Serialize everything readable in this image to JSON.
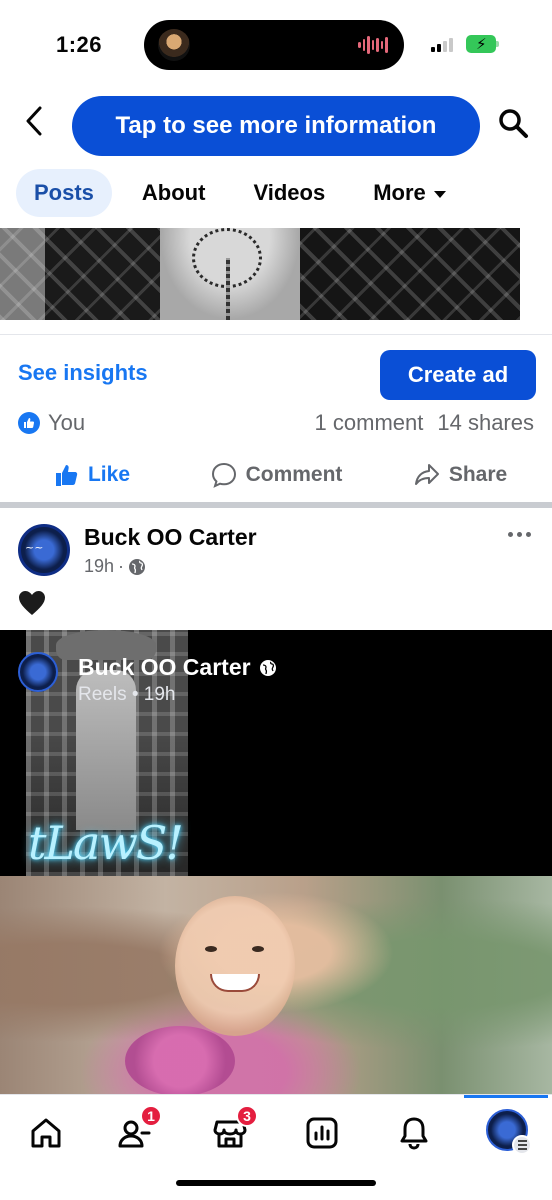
{
  "status_bar": {
    "time": "1:26"
  },
  "header": {
    "info_button_label": "Tap to see more information"
  },
  "tabs": [
    {
      "label": "Posts",
      "active": true
    },
    {
      "label": "About",
      "active": false
    },
    {
      "label": "Videos",
      "active": false
    },
    {
      "label": "More",
      "active": false
    }
  ],
  "post_actions_bar": {
    "insights_label": "See insights",
    "create_ad_label": "Create ad",
    "reaction_by": "You",
    "comments": "1 comment",
    "shares": "14 shares",
    "like_label": "Like",
    "comment_label": "Comment",
    "share_label": "Share"
  },
  "post": {
    "author": "Buck OO Carter",
    "time": "19h",
    "separator": "·",
    "content_emoji": "🖤"
  },
  "reel": {
    "author": "Buck OO Carter",
    "meta": "Reels • 19h",
    "overlay_text": "tLawS!"
  },
  "bottom_nav": {
    "items": [
      {
        "icon": "home-icon"
      },
      {
        "icon": "friends-icon",
        "badge": "1"
      },
      {
        "icon": "marketplace-icon",
        "badge": "3"
      },
      {
        "icon": "dashboard-icon"
      },
      {
        "icon": "notifications-icon"
      },
      {
        "icon": "profile-avatar"
      }
    ]
  },
  "colors": {
    "accent": "#1877f2",
    "primary_button": "#0a4fd6",
    "badge": "#e41e3f",
    "active_tab_bg": "#e7f0fd"
  }
}
